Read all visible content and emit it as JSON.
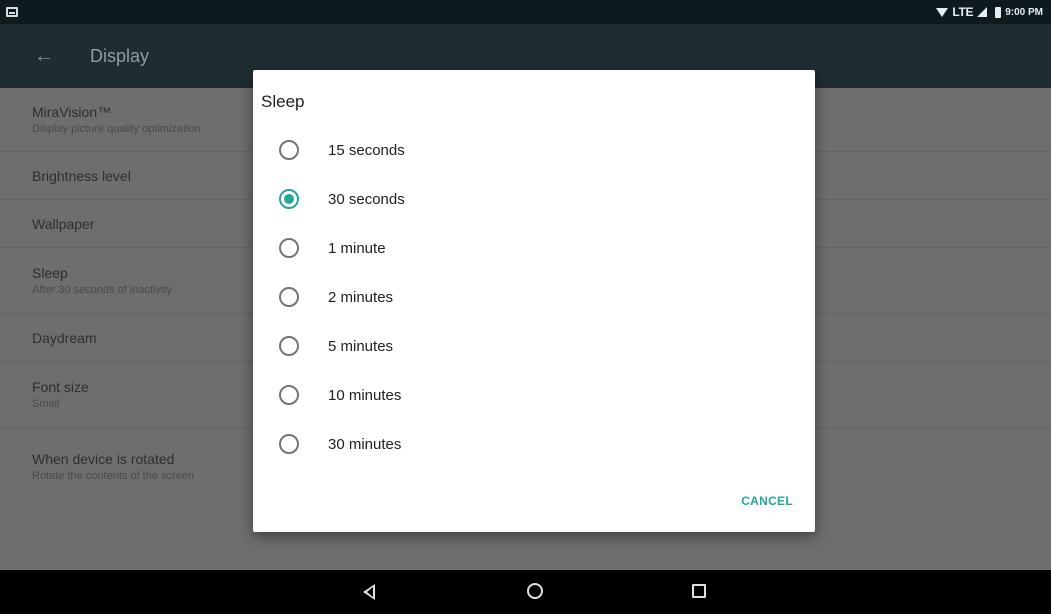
{
  "status_bar": {
    "notification_icon": "screenshot-icon",
    "network_label": "LTE",
    "time": "9:00 PM"
  },
  "app_bar": {
    "back_icon": "arrow-back-icon",
    "title": "Display"
  },
  "settings": {
    "items": [
      {
        "title": "MiraVision™",
        "summary": "Display picture quality optimization"
      },
      {
        "title": "Brightness level",
        "summary": ""
      },
      {
        "title": "Wallpaper",
        "summary": ""
      },
      {
        "title": "Sleep",
        "summary": "After 30 seconds of inactivity"
      },
      {
        "title": "Daydream",
        "summary": ""
      },
      {
        "title": "Font size",
        "summary": "Small"
      },
      {
        "title": "When device is rotated",
        "summary": "Rotate the contents of the screen"
      }
    ]
  },
  "dialog": {
    "title": "Sleep",
    "selected_index": 1,
    "options": [
      {
        "label": "15 seconds",
        "checked": false
      },
      {
        "label": "30 seconds",
        "checked": true
      },
      {
        "label": "1 minute",
        "checked": false
      },
      {
        "label": "2 minutes",
        "checked": false
      },
      {
        "label": "5 minutes",
        "checked": false
      },
      {
        "label": "10 minutes",
        "checked": false
      },
      {
        "label": "30 minutes",
        "checked": false
      }
    ],
    "cancel_label": "CANCEL",
    "accent_color": "#26a69a"
  },
  "nav_bar": {
    "back_icon": "nav-back-icon",
    "home_icon": "nav-home-icon",
    "recents_icon": "nav-recents-icon"
  }
}
